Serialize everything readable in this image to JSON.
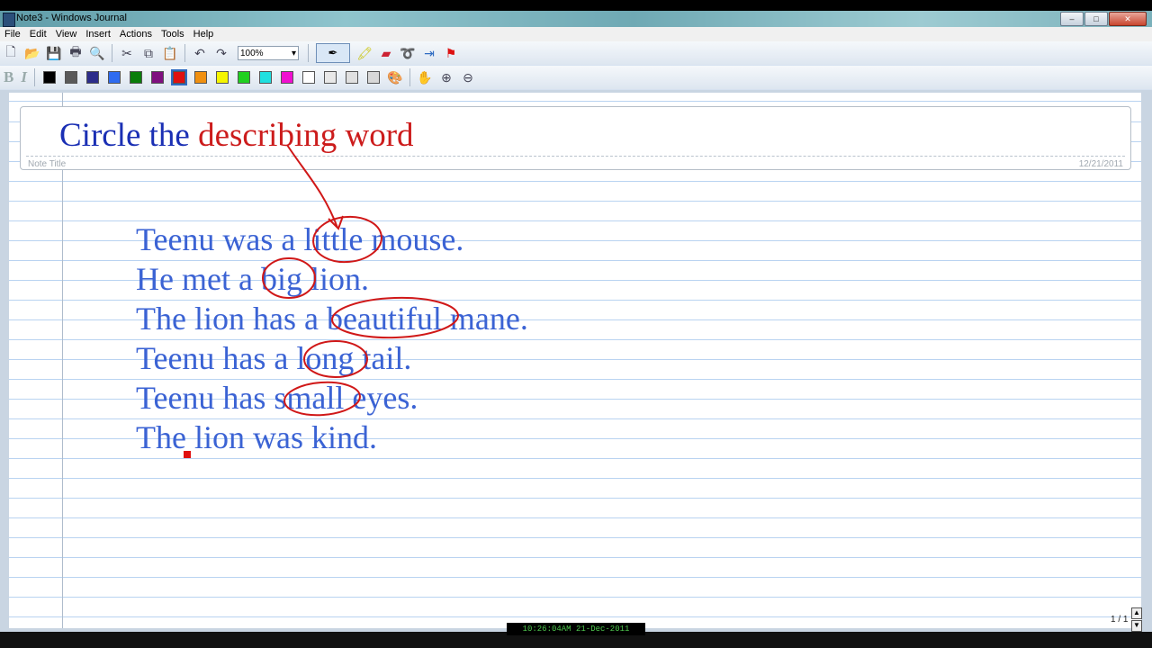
{
  "window": {
    "title": "Note3 - Windows Journal"
  },
  "menu": [
    "File",
    "Edit",
    "View",
    "Insert",
    "Actions",
    "Tools",
    "Help"
  ],
  "toolbar": {
    "zoom_value": "100%",
    "colors": [
      "#000000",
      "#5a5a5a",
      "#2d2d8a",
      "#2f6cf0",
      "#0a7d0a",
      "#7f107f",
      "#e01010",
      "#f09010",
      "#f5f500",
      "#20d020",
      "#20e0e0",
      "#f010d0",
      "#ffffff",
      "#e8e8e8",
      "#e0e0e0",
      "#d8d8d8"
    ],
    "active_color_index": 6
  },
  "page": {
    "heading_part1": "Circle the ",
    "heading_part2": "describing word",
    "note_title_label": "Note Title",
    "date": "12/21/2011",
    "sentences": [
      "Teenu was a little mouse.",
      "He met a big lion.",
      "The lion has a beautiful mane.",
      "Teenu has a long tail.",
      "Teenu has small eyes.",
      "The lion was kind."
    ],
    "circled_words": [
      "little",
      "big",
      "beautiful",
      "long",
      "small"
    ]
  },
  "page_counter": "1 / 1",
  "overlay_clock": "10:26:04AM 21-Dec-2011"
}
